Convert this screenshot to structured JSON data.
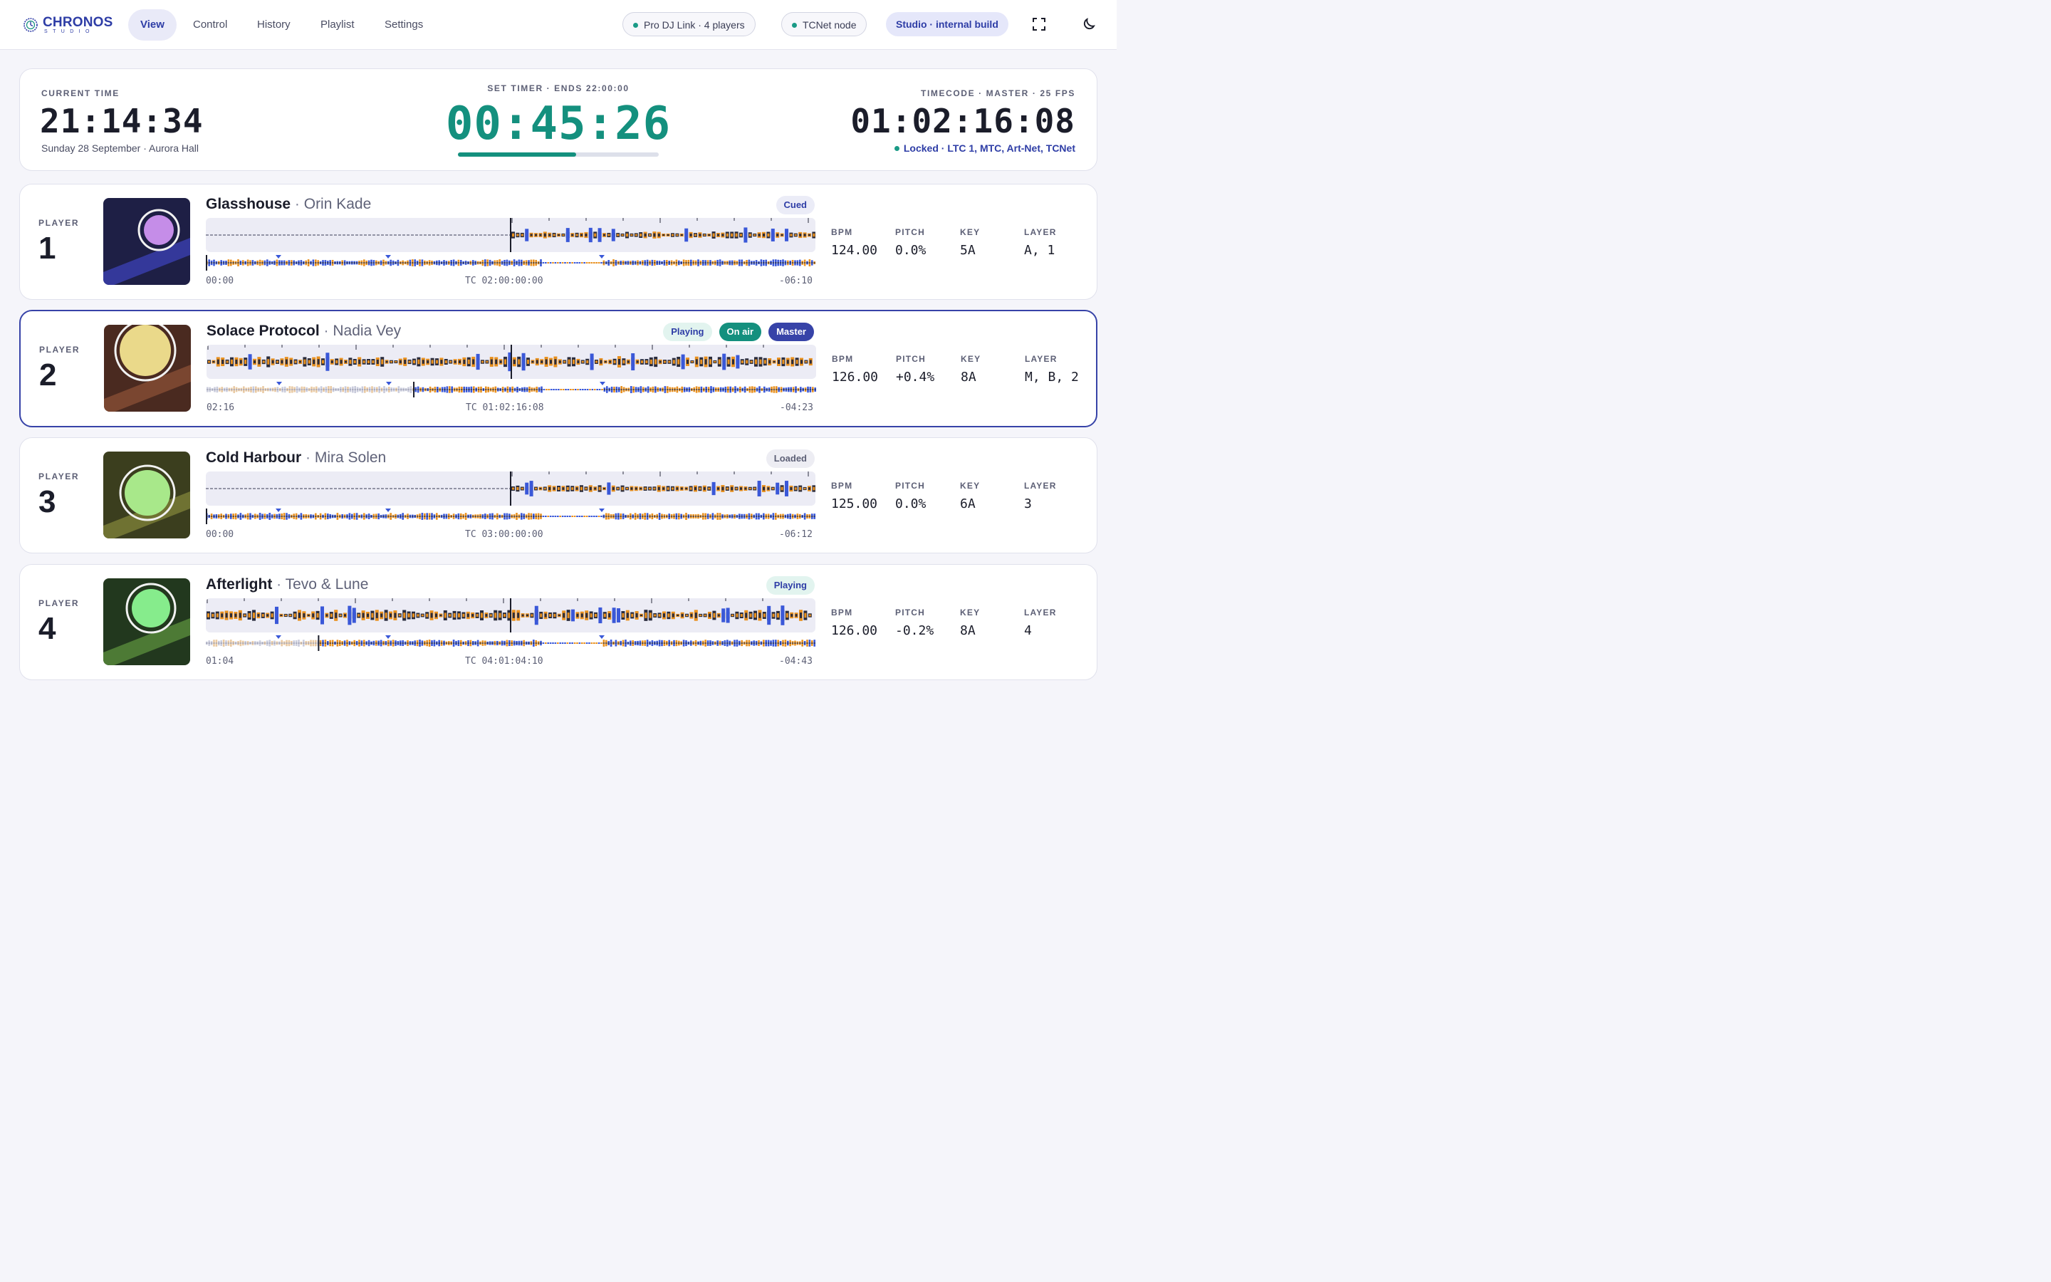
{
  "app": {
    "logo_word": "CHRONOS",
    "logo_sub": "STUDIO",
    "accent": "#2e3da6",
    "teal": "#14907e"
  },
  "nav": [
    {
      "label": "View",
      "active": true
    },
    {
      "label": "Control"
    },
    {
      "label": "History"
    },
    {
      "label": "Playlist"
    },
    {
      "label": "Settings"
    }
  ],
  "status": {
    "prodj": "Pro DJ Link · 4 players",
    "tcnet": "TCNet node",
    "build": "Studio · internal build"
  },
  "icons": {
    "fullscreen": "fullscreen-icon",
    "theme": "moon-icon"
  },
  "clock": {
    "current_label": "CURRENT TIME",
    "current_time": "21:14:34",
    "current_sub": "Sunday 28 September · Aurora Hall",
    "timer_label": "SET TIMER · ENDS 22:00:00",
    "timer_value": "00:45:26",
    "timer_progress": 0.59,
    "tc_label": "TIMECODE · MASTER · 25 FPS",
    "tc_value": "01:02:16:08",
    "tc_status": "Locked · LTC 1, MTC, Art-Net, TCNet"
  },
  "players": [
    {
      "label": "PLAYER",
      "number": "1",
      "title": "Glasshouse",
      "artist": "Orin Kade",
      "badges": [
        {
          "text": "Cued",
          "kind": "cued"
        }
      ],
      "elapsed": "00:00",
      "tc": "TC 02:00:00:00",
      "remaining": "-06:10",
      "progress": 0.0,
      "playing": false,
      "master": false,
      "bpm": "124.00",
      "pitch": "0.0%",
      "key": "5A",
      "layer": "A, 1",
      "art": {
        "bg": "#1e1f45",
        "band": "#34389a",
        "circle": "#c58de8"
      }
    },
    {
      "label": "PLAYER",
      "number": "2",
      "title": "Solace Protocol",
      "artist": "Nadia Vey",
      "badges": [
        {
          "text": "Playing",
          "kind": "playing"
        },
        {
          "text": "On air",
          "kind": "onair"
        },
        {
          "text": "Master",
          "kind": "master"
        }
      ],
      "elapsed": "02:16",
      "tc": "TC 01:02:16:08",
      "remaining": "-04:23",
      "progress": 0.34,
      "playing": true,
      "master": true,
      "bpm": "126.00",
      "pitch": "+0.4%",
      "key": "8A",
      "layer": "M, B, 2",
      "art": {
        "bg": "#4a2a20",
        "band": "#7a4630",
        "circle": "#ead98a"
      }
    },
    {
      "label": "PLAYER",
      "number": "3",
      "title": "Cold Harbour",
      "artist": "Mira Solen",
      "badges": [
        {
          "text": "Loaded",
          "kind": "loaded"
        }
      ],
      "elapsed": "00:00",
      "tc": "TC 03:00:00:00",
      "remaining": "-06:12",
      "progress": 0.0,
      "playing": false,
      "master": false,
      "bpm": "125.00",
      "pitch": "0.0%",
      "key": "6A",
      "layer": "3",
      "art": {
        "bg": "#3b3e1e",
        "band": "#6f7232",
        "circle": "#a8e88a"
      }
    },
    {
      "label": "PLAYER",
      "number": "4",
      "title": "Afterlight",
      "artist": "Tevo & Lune",
      "badges": [
        {
          "text": "Playing",
          "kind": "playing"
        }
      ],
      "elapsed": "01:04",
      "tc": "TC 04:01:04:10",
      "remaining": "-04:43",
      "progress": 0.185,
      "playing": true,
      "master": false,
      "bpm": "126.00",
      "pitch": "-0.2%",
      "key": "8A",
      "layer": "4",
      "art": {
        "bg": "#22381e",
        "band": "#4d7a35",
        "circle": "#86ec8c"
      }
    }
  ],
  "stat_labels": {
    "bpm": "BPM",
    "pitch": "PITCH",
    "key": "KEY",
    "layer": "LAYER"
  }
}
